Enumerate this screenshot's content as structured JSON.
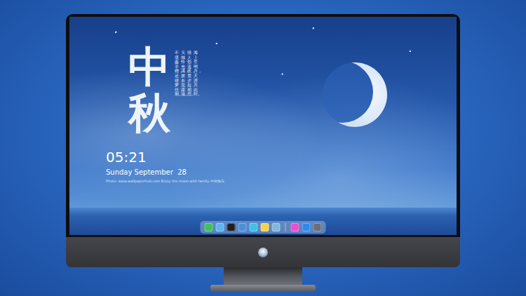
{
  "wallpaper": {
    "title": "中秋",
    "poem_columns": [
      "海上生明月，天涯共此时。",
      "情人怨遥夜，竟夕起相思。",
      "灭烛怜光满，披衣觉露滋。",
      "不堪盈手赠，还寝梦佳期。"
    ]
  },
  "clock": {
    "time": "05:21",
    "date": "Sunday September  28",
    "caption": "Photo: www.wallpaperhub.com  Enjoy the moon with family  中秋快乐"
  },
  "dock": {
    "apps": [
      {
        "color": "#3ec15a"
      },
      {
        "color": "#5fb3f5"
      },
      {
        "color": "#1f1f22"
      },
      {
        "color": "#4a90d9"
      },
      {
        "color": "#3fc0e6"
      },
      {
        "color": "#f5d24a"
      },
      {
        "color": "#7fb8d8"
      }
    ],
    "extras": [
      {
        "color": "#e94fd0"
      },
      {
        "color": "#2f8be8"
      },
      {
        "color": "#6b6f78"
      }
    ]
  }
}
